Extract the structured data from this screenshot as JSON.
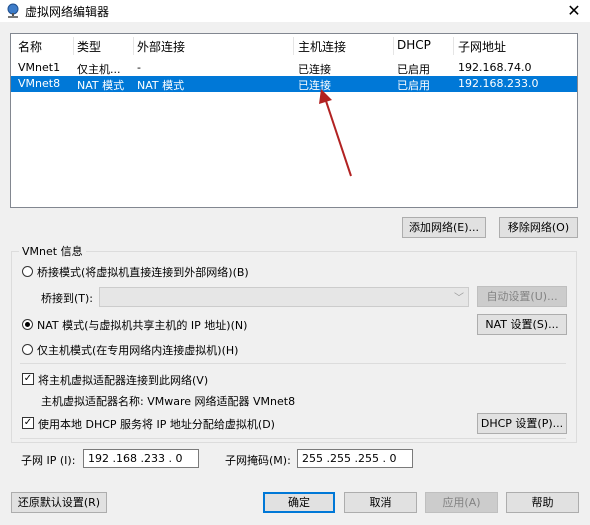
{
  "window": {
    "title": "虚拟网络编辑器",
    "close_glyph": "✕"
  },
  "columns": [
    "名称",
    "类型",
    "外部连接",
    "主机连接",
    "DHCP",
    "子网地址"
  ],
  "rows": [
    {
      "name": "VMnet1",
      "type": "仅主机...",
      "external": "-",
      "host": "已连接",
      "dhcp": "已启用",
      "subnet": "192.168.74.0",
      "selected": false
    },
    {
      "name": "VMnet8",
      "type": "NAT 模式",
      "external": "NAT 模式",
      "host": "已连接",
      "dhcp": "已启用",
      "subnet": "192.168.233.0",
      "selected": true
    }
  ],
  "list_buttons": {
    "add": "添加网络(E)...",
    "remove": "移除网络(O)"
  },
  "vmnet_info": {
    "title": "VMnet 信息",
    "bridged_label": "桥接模式(将虚拟机直接连接到外部网络)(B)",
    "bridge_to_label": "桥接到(T):",
    "bridge_to_value": "",
    "auto_button": "自动设置(U)...",
    "nat_label": "NAT 模式(与虚拟机共享主机的 IP 地址)(N)",
    "nat_button": "NAT 设置(S)...",
    "hostonly_label": "仅主机模式(在专用网络内连接虚拟机)(H)",
    "selected_mode": "nat",
    "connect_adapter_label": "将主机虚拟适配器连接到此网络(V)",
    "connect_adapter_checked": true,
    "adapter_name_label": "主机虚拟适配器名称: VMware 网络适配器 VMnet8",
    "dhcp_label": "使用本地 DHCP 服务将 IP 地址分配给虚拟机(D)",
    "dhcp_checked": true,
    "dhcp_button": "DHCP 设置(P)...",
    "subnet_ip_label": "子网 IP (I):",
    "subnet_ip": "192 .168 .233 . 0",
    "mask_label": "子网掩码(M):",
    "mask": "255 .255 .255 . 0"
  },
  "footer": {
    "restore": "还原默认设置(R)",
    "ok": "确定",
    "cancel": "取消",
    "apply": "应用(A)",
    "help": "帮助"
  },
  "colors": {
    "selection": "#0078d7",
    "arrow": "#b22222"
  }
}
